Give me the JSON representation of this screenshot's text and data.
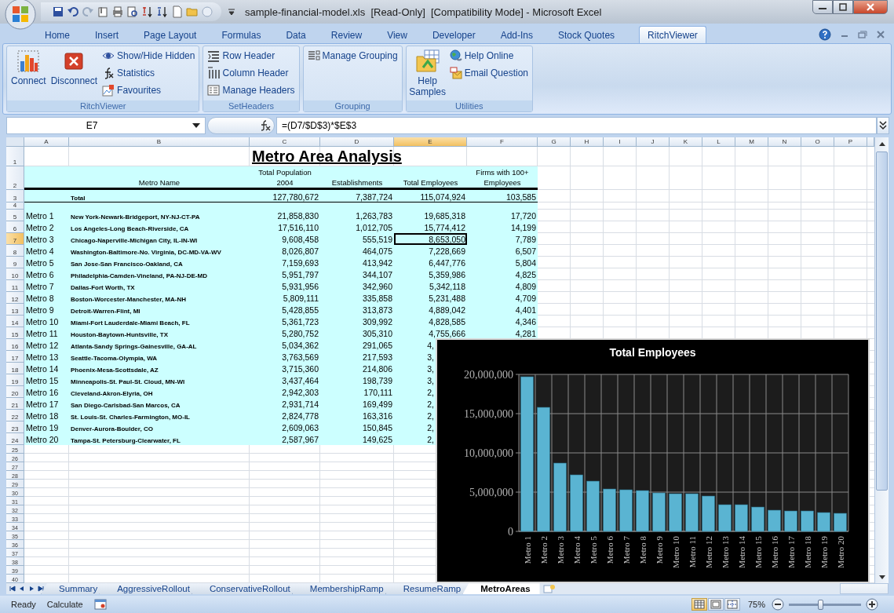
{
  "window": {
    "title": "sample-financial-model.xls  [Read-Only]  [Compatibility Mode] - Microsoft Excel"
  },
  "ribbon_tabs": [
    {
      "label": "Home",
      "selected": false
    },
    {
      "label": "Insert",
      "selected": false
    },
    {
      "label": "Page Layout",
      "selected": false
    },
    {
      "label": "Formulas",
      "selected": false
    },
    {
      "label": "Data",
      "selected": false
    },
    {
      "label": "Review",
      "selected": false
    },
    {
      "label": "View",
      "selected": false
    },
    {
      "label": "Developer",
      "selected": false
    },
    {
      "label": "Add-Ins",
      "selected": false
    },
    {
      "label": "Stock Quotes",
      "selected": false
    },
    {
      "label": "RitchViewer",
      "selected": true
    }
  ],
  "ribbon_groups": [
    {
      "label": "RitchViewer",
      "buttons": [
        {
          "label": "Connect",
          "kind": "large"
        },
        {
          "label": "Disconnect",
          "kind": "large"
        },
        {
          "label": "Show/Hide Hidden",
          "kind": "small"
        },
        {
          "label": "Statistics",
          "kind": "small"
        },
        {
          "label": "Favourites",
          "kind": "small"
        }
      ]
    },
    {
      "label": "SetHeaders",
      "buttons": [
        {
          "label": "Row Header",
          "kind": "small"
        },
        {
          "label": "Column Header",
          "kind": "small"
        },
        {
          "label": "Manage Headers",
          "kind": "small"
        }
      ]
    },
    {
      "label": "Grouping",
      "buttons": [
        {
          "label": "Manage Grouping",
          "kind": "small"
        }
      ]
    },
    {
      "label": "Utilities",
      "buttons": [
        {
          "label": "Help Samples",
          "kind": "large"
        },
        {
          "label": "Help Online",
          "kind": "small"
        },
        {
          "label": "Email Question",
          "kind": "small"
        }
      ]
    }
  ],
  "formula_bar": {
    "name_box": "E7",
    "formula": "=(D7/$D$3)*$E$3"
  },
  "sheet": {
    "columns": [
      {
        "label": "A",
        "selected": false
      },
      {
        "label": "B",
        "selected": false
      },
      {
        "label": "C",
        "selected": false
      },
      {
        "label": "D",
        "selected": false
      },
      {
        "label": "E",
        "selected": true
      },
      {
        "label": "F",
        "selected": false
      },
      {
        "label": "G",
        "selected": false
      },
      {
        "label": "H",
        "selected": false
      },
      {
        "label": "I",
        "selected": false
      },
      {
        "label": "J",
        "selected": false
      },
      {
        "label": "K",
        "selected": false
      },
      {
        "label": "L",
        "selected": false
      },
      {
        "label": "M",
        "selected": false
      },
      {
        "label": "N",
        "selected": false
      },
      {
        "label": "O",
        "selected": false
      },
      {
        "label": "P",
        "selected": false
      }
    ],
    "rows": [
      {
        "number": "1",
        "kind": "title",
        "selected": false,
        "cells": {
          "C": "Metro Area Analysis"
        }
      },
      {
        "number": "2",
        "kind": "header",
        "selected": false,
        "cells": {
          "B": "Metro Name",
          "C": "Total Population 2004",
          "D": "Establishments",
          "E": "Total Employees",
          "F": "Firms with 100+ Employees"
        }
      },
      {
        "number": "3",
        "kind": "total",
        "selected": false,
        "cells": {
          "B": "Total",
          "C": "127,780,672",
          "D": "7,387,724",
          "E": "115,074,924",
          "F": "103,585"
        }
      },
      {
        "number": "4",
        "kind": "spacer",
        "selected": false,
        "cells": {}
      },
      {
        "number": "5",
        "kind": "data",
        "selected": false,
        "cells": {
          "A": "Metro 1",
          "B": "New York-Newark-Bridgeport, NY-NJ-CT-PA",
          "C": "21,858,830",
          "D": "1,263,783",
          "E": "19,685,318",
          "F": "17,720"
        }
      },
      {
        "number": "6",
        "kind": "data",
        "selected": false,
        "cells": {
          "A": "Metro 2",
          "B": "Los Angeles-Long Beach-Riverside, CA",
          "C": "17,516,110",
          "D": "1,012,705",
          "E": "15,774,412",
          "F": "14,199"
        }
      },
      {
        "number": "7",
        "kind": "data",
        "selected": true,
        "cells": {
          "A": "Metro 3",
          "B": "Chicago-Naperville-Michigan City, IL-IN-WI",
          "C": "9,608,458",
          "D": "555,519",
          "E": "8,653,050",
          "F": "7,789"
        }
      },
      {
        "number": "8",
        "kind": "data",
        "selected": false,
        "cells": {
          "A": "Metro 4",
          "B": "Washington-Baltimore-No. Virginia, DC-MD-VA-WV",
          "C": "8,026,807",
          "D": "464,075",
          "E": "7,228,669",
          "F": "6,507"
        }
      },
      {
        "number": "9",
        "kind": "data",
        "selected": false,
        "cells": {
          "A": "Metro 5",
          "B": "San Jose-San Francisco-Oakland, CA",
          "C": "7,159,693",
          "D": "413,942",
          "E": "6,447,776",
          "F": "5,804"
        }
      },
      {
        "number": "10",
        "kind": "data",
        "selected": false,
        "cells": {
          "A": "Metro 6",
          "B": "Philadelphia-Camden-Vineland, PA-NJ-DE-MD",
          "C": "5,951,797",
          "D": "344,107",
          "E": "5,359,986",
          "F": "4,825"
        }
      },
      {
        "number": "11",
        "kind": "data",
        "selected": false,
        "cells": {
          "A": "Metro 7",
          "B": "Dallas-Fort Worth, TX",
          "C": "5,931,956",
          "D": "342,960",
          "E": "5,342,118",
          "F": "4,809"
        }
      },
      {
        "number": "12",
        "kind": "data",
        "selected": false,
        "cells": {
          "A": "Metro 8",
          "B": "Boston-Worcester-Manchester, MA-NH",
          "C": "5,809,111",
          "D": "335,858",
          "E": "5,231,488",
          "F": "4,709"
        }
      },
      {
        "number": "13",
        "kind": "data",
        "selected": false,
        "cells": {
          "A": "Metro 9",
          "B": "Detroit-Warren-Flint, MI",
          "C": "5,428,855",
          "D": "313,873",
          "E": "4,889,042",
          "F": "4,401"
        }
      },
      {
        "number": "14",
        "kind": "data",
        "selected": false,
        "cells": {
          "A": "Metro 10",
          "B": "Miami-Fort Lauderdale-Miami Beach, FL",
          "C": "5,361,723",
          "D": "309,992",
          "E": "4,828,585",
          "F": "4,346"
        }
      },
      {
        "number": "15",
        "kind": "data",
        "selected": false,
        "cells": {
          "A": "Metro 11",
          "B": "Houston-Baytown-Huntsville, TX",
          "C": "5,280,752",
          "D": "305,310",
          "E": "4,755,666",
          "F": "4,281"
        }
      },
      {
        "number": "16",
        "kind": "data",
        "selected": false,
        "cells": {
          "A": "Metro 12",
          "B": "Atlanta-Sandy Springs-Gainesville, GA-AL",
          "C": "5,034,362",
          "D": "291,065",
          "E": {
            "text": "4,",
            "cut_off": true
          }
        }
      },
      {
        "number": "17",
        "kind": "data",
        "selected": false,
        "cells": {
          "A": "Metro 13",
          "B": "Seattle-Tacoma-Olympia, WA",
          "C": "3,763,569",
          "D": "217,593",
          "E": {
            "text": "3,",
            "cut_off": true
          }
        }
      },
      {
        "number": "18",
        "kind": "data",
        "selected": false,
        "cells": {
          "A": "Metro 14",
          "B": "Phoenix-Mesa-Scottsdale, AZ",
          "C": "3,715,360",
          "D": "214,806",
          "E": {
            "text": "3,",
            "cut_off": true
          }
        }
      },
      {
        "number": "19",
        "kind": "data",
        "selected": false,
        "cells": {
          "A": "Metro 15",
          "B": "Minneapolis-St. Paul-St. Cloud, MN-WI",
          "C": "3,437,464",
          "D": "198,739",
          "E": {
            "text": "3,",
            "cut_off": true
          }
        }
      },
      {
        "number": "20",
        "kind": "data",
        "selected": false,
        "cells": {
          "A": "Metro 16",
          "B": "Cleveland-Akron-Elyria, OH",
          "C": "2,942,303",
          "D": "170,111",
          "E": {
            "text": "2,",
            "cut_off": true
          }
        }
      },
      {
        "number": "21",
        "kind": "data",
        "selected": false,
        "cells": {
          "A": "Metro 17",
          "B": "San Diego-Carlsbad-San Marcos, CA",
          "C": "2,931,714",
          "D": "169,499",
          "E": {
            "text": "2,",
            "cut_off": true
          }
        }
      },
      {
        "number": "22",
        "kind": "data",
        "selected": false,
        "cells": {
          "A": "Metro 18",
          "B": "St. Louis-St. Charles-Farmington, MO-IL",
          "C": "2,824,778",
          "D": "163,316",
          "E": {
            "text": "2,",
            "cut_off": true
          }
        }
      },
      {
        "number": "23",
        "kind": "data",
        "selected": false,
        "cells": {
          "A": "Metro 19",
          "B": "Denver-Aurora-Boulder, CO",
          "C": "2,609,063",
          "D": "150,845",
          "E": {
            "text": "2,",
            "cut_off": true
          }
        }
      },
      {
        "number": "24",
        "kind": "data",
        "selected": false,
        "cells": {
          "A": "Metro 20",
          "B": "Tampa-St. Petersburg-Clearwater, FL",
          "C": "2,587,967",
          "D": "149,625",
          "E": {
            "text": "2,",
            "cut_off": true
          }
        }
      },
      {
        "number": "25",
        "kind": "empty",
        "selected": false,
        "cells": {}
      },
      {
        "number": "26",
        "kind": "empty",
        "selected": false,
        "cells": {}
      },
      {
        "number": "27",
        "kind": "empty",
        "selected": false,
        "cells": {}
      },
      {
        "number": "28",
        "kind": "empty",
        "selected": false,
        "cells": {}
      },
      {
        "number": "29",
        "kind": "empty",
        "selected": false,
        "cells": {}
      },
      {
        "number": "30",
        "kind": "empty",
        "selected": false,
        "cells": {}
      },
      {
        "number": "31",
        "kind": "empty",
        "selected": false,
        "cells": {}
      },
      {
        "number": "32",
        "kind": "empty",
        "selected": false,
        "cells": {}
      },
      {
        "number": "33",
        "kind": "empty",
        "selected": false,
        "cells": {}
      },
      {
        "number": "34",
        "kind": "empty",
        "selected": false,
        "cells": {}
      },
      {
        "number": "35",
        "kind": "empty",
        "selected": false,
        "cells": {}
      },
      {
        "number": "36",
        "kind": "empty",
        "selected": false,
        "cells": {}
      },
      {
        "number": "37",
        "kind": "empty",
        "selected": false,
        "cells": {}
      },
      {
        "number": "38",
        "kind": "empty",
        "selected": false,
        "cells": {}
      },
      {
        "number": "39",
        "kind": "empty",
        "selected": false,
        "cells": {}
      },
      {
        "number": "40",
        "kind": "empty",
        "selected": false,
        "cells": {}
      }
    ]
  },
  "chart": {
    "chart_data": {
      "type": "bar",
      "title": "Total Employees",
      "categories": [
        "Metro 1",
        "Metro 2",
        "Metro 3",
        "Metro 4",
        "Metro 5",
        "Metro 6",
        "Metro 7",
        "Metro 8",
        "Metro 9",
        "Metro 10",
        "Metro 11",
        "Metro 12",
        "Metro 13",
        "Metro 14",
        "Metro 15",
        "Metro 16",
        "Metro 17",
        "Metro 18",
        "Metro 19",
        "Metro 20"
      ],
      "series": [
        {
          "color": "#5ab4d2",
          "values": [
            19700000,
            15800000,
            8700000,
            7200000,
            6400000,
            5400000,
            5300000,
            5200000,
            4900000,
            4800000,
            4800000,
            4500000,
            3400000,
            3400000,
            3100000,
            2700000,
            2600000,
            2600000,
            2400000,
            2300000
          ]
        }
      ],
      "grid": true,
      "ylim": [
        0,
        20000000
      ],
      "yticks": [
        {
          "value": 0,
          "label": "0"
        },
        {
          "value": 5000000,
          "label": "5,000,000"
        },
        {
          "value": 10000000,
          "label": "10,000,000"
        },
        {
          "value": 15000000,
          "label": "15,000,000"
        },
        {
          "value": 20000000,
          "label": "20,000,000"
        }
      ]
    }
  },
  "sheet_tabs": [
    {
      "label": "Summary",
      "selected": false
    },
    {
      "label": "AggressiveRollout",
      "selected": false
    },
    {
      "label": "ConservativeRollout",
      "selected": false
    },
    {
      "label": "MembershipRamp",
      "selected": false
    },
    {
      "label": "ResumeRamp",
      "selected": false
    },
    {
      "label": "MetroAreas",
      "selected": true
    }
  ],
  "status_bar": {
    "items": [
      "Ready",
      "Calculate"
    ],
    "views": [
      {
        "kind": "normal",
        "selected": true
      },
      {
        "kind": "page_layout",
        "selected": false
      },
      {
        "kind": "page_break",
        "selected": false
      }
    ],
    "zoom": "75%",
    "zoom_slider": {
      "level": 0.45
    }
  }
}
